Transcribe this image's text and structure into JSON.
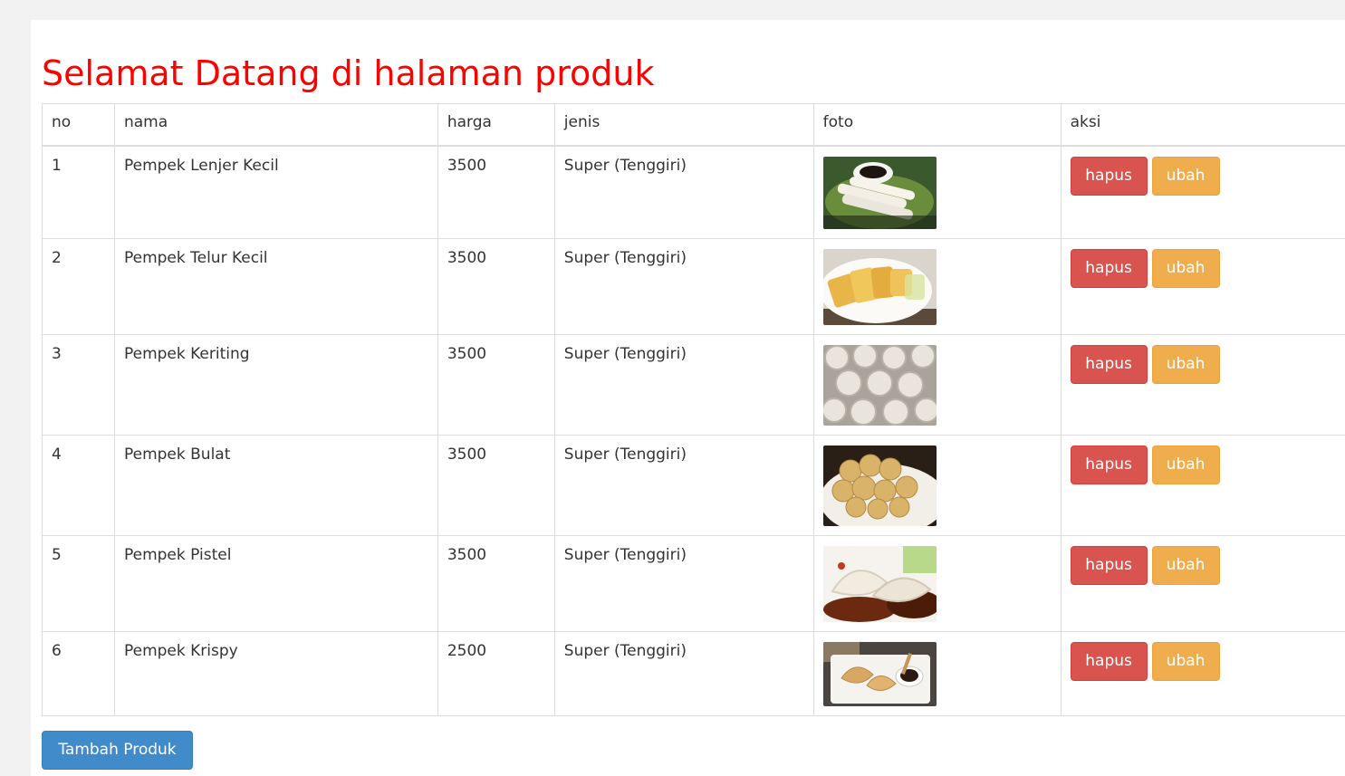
{
  "page": {
    "title": "Selamat Datang di halaman produk",
    "title_color": "#ff0000"
  },
  "table": {
    "headers": {
      "no": "no",
      "nama": "nama",
      "harga": "harga",
      "jenis": "jenis",
      "foto": "foto",
      "aksi": "aksi"
    },
    "rows": [
      {
        "no": "1",
        "nama": "Pempek Lenjer Kecil",
        "harga": "3500",
        "jenis": "Super (Tenggiri)",
        "foto": "pempek-lenjer-photo",
        "hapus": "hapus",
        "ubah": "ubah"
      },
      {
        "no": "2",
        "nama": "Pempek Telur Kecil",
        "harga": "3500",
        "jenis": "Super (Tenggiri)",
        "foto": "pempek-telur-photo",
        "hapus": "hapus",
        "ubah": "ubah"
      },
      {
        "no": "3",
        "nama": "Pempek Keriting",
        "harga": "3500",
        "jenis": "Super (Tenggiri)",
        "foto": "pempek-keriting-photo",
        "hapus": "hapus",
        "ubah": "ubah"
      },
      {
        "no": "4",
        "nama": "Pempek Bulat",
        "harga": "3500",
        "jenis": "Super (Tenggiri)",
        "foto": "pempek-bulat-photo",
        "hapus": "hapus",
        "ubah": "ubah"
      },
      {
        "no": "5",
        "nama": "Pempek Pistel",
        "harga": "3500",
        "jenis": "Super (Tenggiri)",
        "foto": "pempek-pistel-photo",
        "hapus": "hapus",
        "ubah": "ubah"
      },
      {
        "no": "6",
        "nama": "Pempek Krispy",
        "harga": "2500",
        "jenis": "Super (Tenggiri)",
        "foto": "pempek-krispy-photo",
        "hapus": "hapus",
        "ubah": "ubah"
      }
    ]
  },
  "actions": {
    "add_label": "Tambah Produk"
  },
  "colors": {
    "hapus": "#d9534f",
    "ubah": "#f0ad4e",
    "tambah": "#428bca"
  }
}
